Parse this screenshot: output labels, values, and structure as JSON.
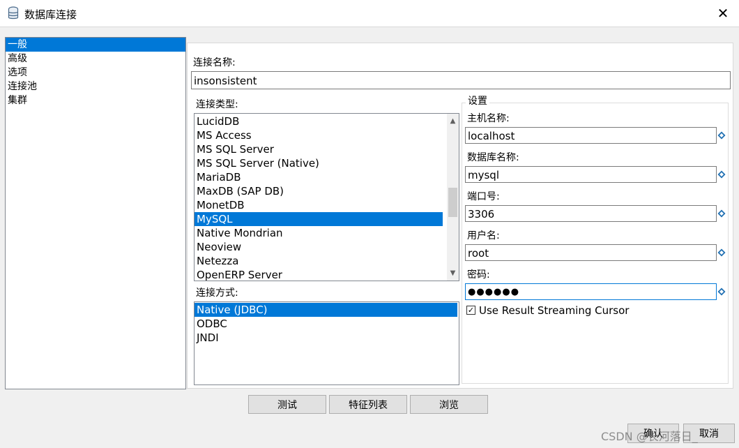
{
  "window": {
    "title": "数据库连接",
    "close_glyph": "✕"
  },
  "nav": {
    "items": [
      "一般",
      "高级",
      "选项",
      "连接池",
      "集群"
    ],
    "selected_index": 0
  },
  "connection_name": {
    "label": "连接名称:",
    "value": "insonsistent"
  },
  "connection_type": {
    "label": "连接类型:",
    "items": [
      "LucidDB",
      "MS Access",
      "MS SQL Server",
      "MS SQL Server (Native)",
      "MariaDB",
      "MaxDB (SAP DB)",
      "MonetDB",
      "MySQL",
      "Native Mondrian",
      "Neoview",
      "Netezza",
      "OpenERP Server"
    ],
    "selected": "MySQL"
  },
  "access_method": {
    "label": "连接方式:",
    "items": [
      "Native (JDBC)",
      "ODBC",
      "JNDI"
    ],
    "selected": "Native (JDBC)"
  },
  "settings": {
    "title": "设置",
    "host_label": "主机名称:",
    "host_value": "localhost",
    "db_label": "数据库名称:",
    "db_value": "mysql",
    "port_label": "端口号:",
    "port_value": "3306",
    "user_label": "用户名:",
    "user_value": "root",
    "password_label": "密码:",
    "password_value": "●●●●●●",
    "streaming_label": "Use Result Streaming Cursor",
    "streaming_checked": true
  },
  "buttons": {
    "test": "测试",
    "features": "特征列表",
    "explore": "浏览",
    "ok": "确认",
    "cancel": "取消"
  },
  "watermark": "CSDN @长河落日_",
  "colors": {
    "selection": "#0078d7",
    "variable_icon": "#1f6fb2"
  }
}
